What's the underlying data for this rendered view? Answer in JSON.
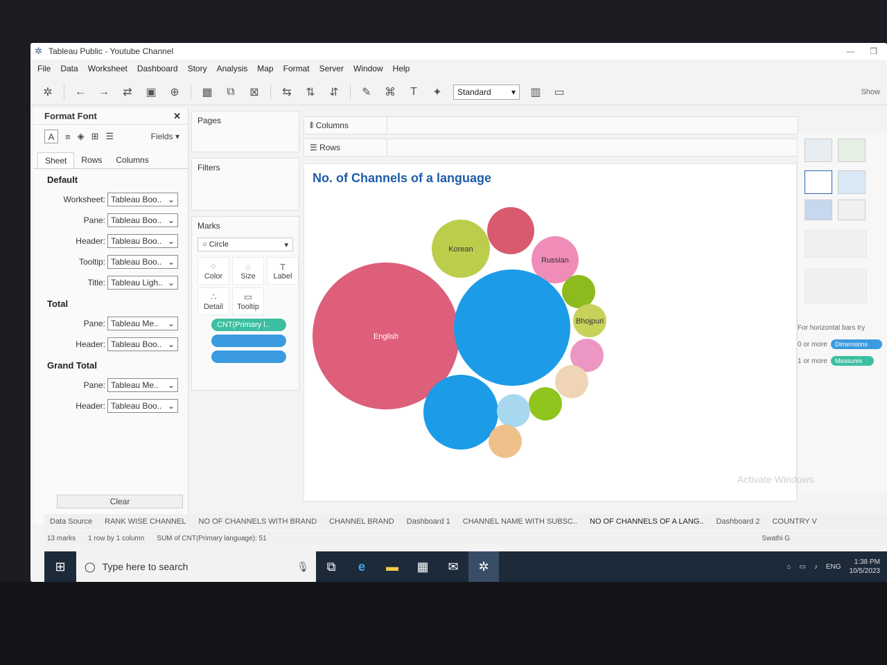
{
  "window": {
    "title": "Tableau Public - Youtube Channel"
  },
  "menu": [
    "File",
    "Data",
    "Worksheet",
    "Dashboard",
    "Story",
    "Analysis",
    "Map",
    "Format",
    "Server",
    "Window",
    "Help"
  ],
  "toolbar": {
    "fit": "Standard",
    "show_me": "Show"
  },
  "format_pane": {
    "title": "Format Font",
    "fields_label": "Fields",
    "tabs": [
      "Sheet",
      "Rows",
      "Columns"
    ],
    "default_heading": "Default",
    "default_rows": [
      {
        "label": "Worksheet:",
        "value": "Tableau Boo.."
      },
      {
        "label": "Pane:",
        "value": "Tableau Boo.."
      },
      {
        "label": "Header:",
        "value": "Tableau Boo.."
      },
      {
        "label": "Tooltip:",
        "value": "Tableau Boo.."
      },
      {
        "label": "Title:",
        "value": "Tableau Ligh.."
      }
    ],
    "total_heading": "Total",
    "total_rows": [
      {
        "label": "Pane:",
        "value": "Tableau Me.."
      },
      {
        "label": "Header:",
        "value": "Tableau Boo.."
      }
    ],
    "grand_heading": "Grand Total",
    "grand_rows": [
      {
        "label": "Pane:",
        "value": "Tableau Me.."
      },
      {
        "label": "Header:",
        "value": "Tableau Boo.."
      }
    ],
    "clear": "Clear"
  },
  "cards": {
    "pages": "Pages",
    "filters": "Filters",
    "marks": "Marks",
    "mark_type": "Circle",
    "buttons": [
      "Color",
      "Size",
      "Label",
      "Detail",
      "Tooltip"
    ],
    "pill_1": "CNT(Primary l.."
  },
  "shelves": {
    "columns": "Columns",
    "rows": "Rows"
  },
  "view": {
    "title": "No. of Channels of a language"
  },
  "chart_data": {
    "type": "bubble",
    "title": "No. of Channels of a language",
    "bubbles": [
      {
        "label": "English",
        "color": "#dd5f7a"
      },
      {
        "label": "Korean",
        "color": "#bccd4c"
      },
      {
        "label": "",
        "color": "#d85a6e"
      },
      {
        "label": "Russian",
        "color": "#ef8db8"
      },
      {
        "label": "",
        "color": "#1c9be6"
      },
      {
        "label": "",
        "color": "#1c9be6"
      },
      {
        "label": "",
        "color": "#8dbb1e"
      },
      {
        "label": "Bhojpuri",
        "color": "#c8d15a"
      },
      {
        "label": "",
        "color": "#ec96c4"
      },
      {
        "label": "",
        "color": "#efd5b5"
      },
      {
        "label": "",
        "color": "#8fc41c"
      },
      {
        "label": "",
        "color": "#a8d8f0"
      },
      {
        "label": "",
        "color": "#eec08a"
      }
    ]
  },
  "show_me": {
    "hint_title": "For horizontal bars try",
    "hint_1": "0 or more",
    "hint_1_pill": "Dimensions",
    "hint_2": "1 or more",
    "hint_2_pill": "Measures"
  },
  "sheet_tabs": [
    "Data Source",
    "RANK WISE CHANNEL",
    "NO OF CHANNELS WITH BRAND",
    "CHANNEL BRAND",
    "Dashboard 1",
    "CHANNEL NAME WITH SUBSC..",
    "NO OF CHANNELS OF A LANG..",
    "Dashboard 2",
    "COUNTRY V"
  ],
  "status": {
    "marks": "13 marks",
    "dims": "1 row by 1 column",
    "sum": "SUM of CNT(Primary language): 51",
    "user": "Swathi G"
  },
  "watermark": "Activate Windows",
  "taskbar": {
    "search_placeholder": "Type here to search",
    "lang": "ENG",
    "time": "1:38 PM",
    "date": "10/5/2023"
  }
}
